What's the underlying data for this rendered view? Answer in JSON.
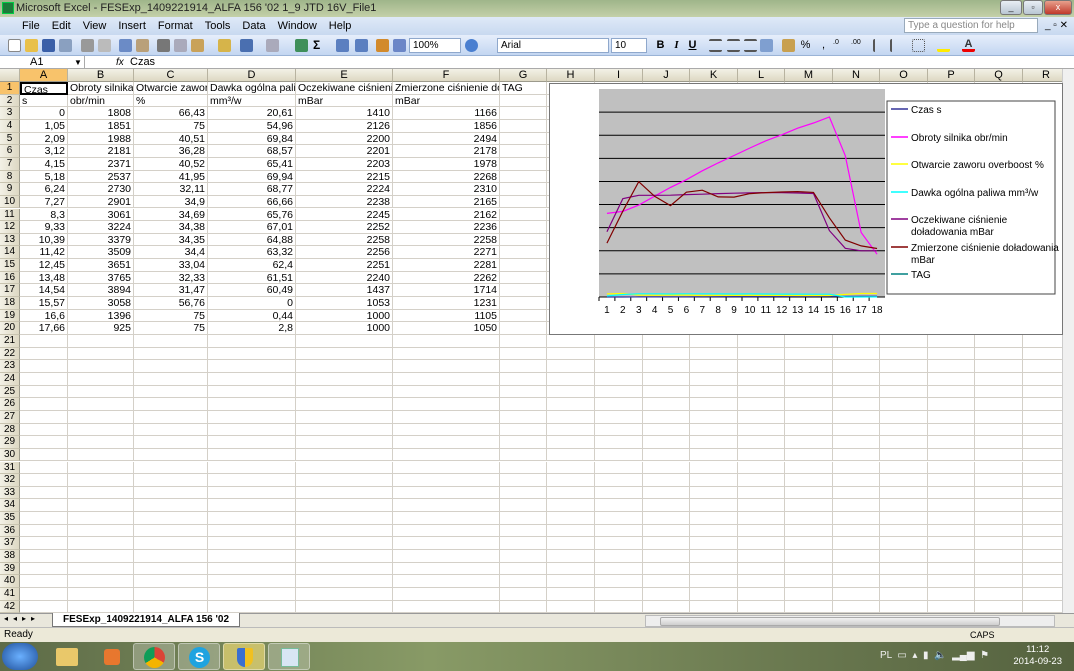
{
  "window": {
    "title": "Microsoft Excel - FESExp_1409221914_ALFA 156 '02 1_9 JTD 16V_File1"
  },
  "menu": [
    "File",
    "Edit",
    "View",
    "Insert",
    "Format",
    "Tools",
    "Data",
    "Window",
    "Help"
  ],
  "help_placeholder": "Type a question for help",
  "toolbar": {
    "zoom": "100%",
    "font": "Arial",
    "font_size": "10",
    "bold": "B",
    "italic": "I",
    "underline": "U",
    "percent": "%",
    "comma": ","
  },
  "formula_bar": {
    "name_box": "A1",
    "fx": "fx",
    "value": "Czas"
  },
  "columns": [
    "A",
    "B",
    "C",
    "D",
    "E",
    "F",
    "G",
    "H",
    "I",
    "J",
    "K",
    "L",
    "M",
    "N",
    "O",
    "P",
    "Q",
    "R"
  ],
  "row_count": 42,
  "cells": [
    [
      "Czas",
      "Obroty silnika",
      "Otwarcie zaworu",
      "Dawka ogólna paliw",
      "Oczekiwane ciśnienie",
      "Zmierzone ciśnienie doła",
      "TAG"
    ],
    [
      "s",
      "obr/min",
      "%",
      "mm³/w",
      "mBar",
      "mBar",
      ""
    ],
    [
      "0",
      "1808",
      "66,43",
      "20,61",
      "1410",
      "1166",
      ""
    ],
    [
      "1,05",
      "1851",
      "75",
      "54,96",
      "2126",
      "1856",
      ""
    ],
    [
      "2,09",
      "1988",
      "40,51",
      "69,84",
      "2200",
      "2494",
      ""
    ],
    [
      "3,12",
      "2181",
      "36,28",
      "68,57",
      "2201",
      "2178",
      ""
    ],
    [
      "4,15",
      "2371",
      "40,52",
      "65,41",
      "2203",
      "1978",
      ""
    ],
    [
      "5,18",
      "2537",
      "41,95",
      "69,94",
      "2215",
      "2268",
      ""
    ],
    [
      "6,24",
      "2730",
      "32,11",
      "68,77",
      "2224",
      "2310",
      ""
    ],
    [
      "7,27",
      "2901",
      "34,9",
      "66,66",
      "2238",
      "2165",
      ""
    ],
    [
      "8,3",
      "3061",
      "34,69",
      "65,76",
      "2245",
      "2162",
      ""
    ],
    [
      "9,33",
      "3224",
      "34,38",
      "67,01",
      "2252",
      "2236",
      ""
    ],
    [
      "10,39",
      "3379",
      "34,35",
      "64,88",
      "2258",
      "2258",
      ""
    ],
    [
      "11,42",
      "3509",
      "34,4",
      "63,32",
      "2256",
      "2271",
      ""
    ],
    [
      "12,45",
      "3651",
      "33,04",
      "62,4",
      "2251",
      "2281",
      ""
    ],
    [
      "13,48",
      "3765",
      "32,33",
      "61,51",
      "2240",
      "2262",
      ""
    ],
    [
      "14,54",
      "3894",
      "31,47",
      "60,49",
      "1437",
      "1714",
      ""
    ],
    [
      "15,57",
      "3058",
      "56,76",
      "0",
      "1053",
      "1231",
      ""
    ],
    [
      "16,6",
      "1396",
      "75",
      "0,44",
      "1000",
      "1105",
      ""
    ],
    [
      "17,66",
      "925",
      "75",
      "2,8",
      "1000",
      "1050",
      ""
    ]
  ],
  "chart_data": {
    "type": "line",
    "categories": [
      "1",
      "2",
      "3",
      "4",
      "5",
      "6",
      "7",
      "8",
      "9",
      "10",
      "11",
      "12",
      "13",
      "14",
      "15",
      "16",
      "17",
      "18"
    ],
    "ylim": [
      0,
      4500
    ],
    "y_grid_step": 500,
    "grid": true,
    "plot_background": "#c0c0c0",
    "legend_position": "right",
    "series": [
      {
        "name": "Czas s",
        "color": "#333399",
        "values": [
          0,
          1.05,
          2.09,
          3.12,
          4.15,
          5.18,
          6.24,
          7.27,
          8.3,
          9.33,
          10.39,
          11.42,
          12.45,
          13.48,
          14.54,
          15.57,
          16.6,
          17.66
        ]
      },
      {
        "name": "Obroty silnika obr/min",
        "color": "#ff00ff",
        "values": [
          1808,
          1851,
          1988,
          2181,
          2371,
          2537,
          2730,
          2901,
          3061,
          3224,
          3379,
          3509,
          3651,
          3765,
          3894,
          3058,
          1396,
          925
        ]
      },
      {
        "name": "Otwarcie zaworu overboost %",
        "color": "#ffff00",
        "values": [
          66.43,
          75,
          40.51,
          36.28,
          40.52,
          41.95,
          32.11,
          34.9,
          34.69,
          34.38,
          34.35,
          34.4,
          33.04,
          32.33,
          31.47,
          56.76,
          75,
          75
        ]
      },
      {
        "name": "Dawka ogólna paliwa mm³/w",
        "color": "#00ffff",
        "values": [
          20.61,
          54.96,
          69.84,
          68.57,
          65.41,
          69.94,
          68.77,
          66.66,
          65.76,
          67.01,
          64.88,
          63.32,
          62.4,
          61.51,
          60.49,
          0,
          0.44,
          2.8
        ]
      },
      {
        "name": "Oczekiwane ciśnienie doładowania mBar",
        "color": "#800080",
        "values": [
          1410,
          2126,
          2200,
          2201,
          2203,
          2215,
          2224,
          2238,
          2245,
          2252,
          2258,
          2256,
          2251,
          2240,
          1437,
          1053,
          1000,
          1000
        ]
      },
      {
        "name": "Zmierzone ciśnienie doładowania mBar",
        "color": "#800000",
        "values": [
          1166,
          1856,
          2494,
          2178,
          1978,
          2268,
          2310,
          2165,
          2162,
          2236,
          2258,
          2271,
          2281,
          2262,
          1714,
          1231,
          1105,
          1050
        ]
      },
      {
        "name": "TAG",
        "color": "#008080",
        "values": []
      }
    ]
  },
  "sheet_tab": "FESExp_1409221914_ALFA 156 '02",
  "status": {
    "ready": "Ready",
    "caps": "CAPS"
  },
  "taskbar": {
    "lang": "PL",
    "time": "11:12",
    "date": "2014-09-23"
  }
}
